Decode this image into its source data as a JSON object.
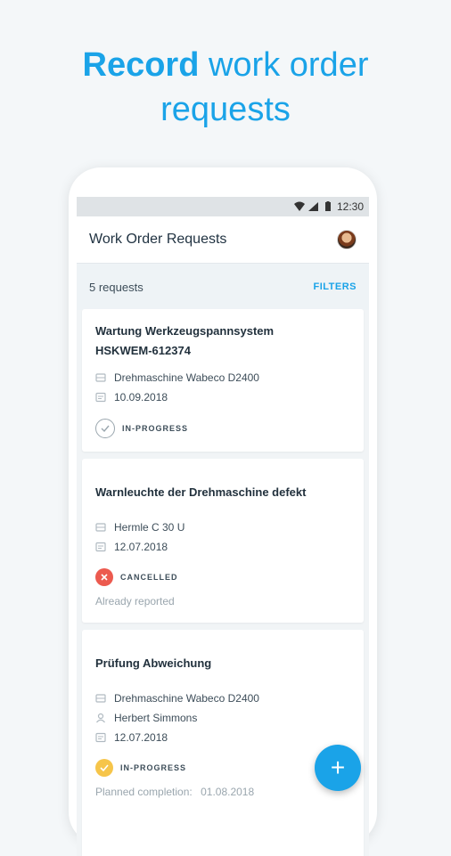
{
  "headline": {
    "bold": "Record",
    "rest_line1": " work order",
    "line2": "requests"
  },
  "statusbar": {
    "time": "12:30"
  },
  "appbar": {
    "title": "Work Order Requests"
  },
  "list": {
    "count_label": "5 requests",
    "filters_label": "FILTERS"
  },
  "cards": [
    {
      "title_line1": "Wartung Werkzeugspannsystem",
      "title_line2": "HSKWEM-612374",
      "machine": "Drehmaschine Wabeco D2400",
      "date": "10.09.2018",
      "status": "IN-PROGRESS"
    },
    {
      "title_line1": "Warnleuchte der Drehmaschine defekt",
      "machine": "Hermle C 30 U",
      "date": "12.07.2018",
      "status": "CANCELLED",
      "note": "Already reported"
    },
    {
      "title_line1": "Prüfung Abweichung",
      "machine": "Drehmaschine Wabeco D2400",
      "person": "Herbert Simmons",
      "date": "12.07.2018",
      "status": "IN-PROGRESS",
      "planned_label": "Planned completion:",
      "planned_date": "01.08.2018"
    }
  ],
  "fab": {
    "label": "+"
  },
  "colors": {
    "accent": "#1aa3e8",
    "cancelled": "#ec5a4f",
    "in_progress_yellow": "#f6c54a",
    "in_progress_outline": "#9aa6ae"
  }
}
